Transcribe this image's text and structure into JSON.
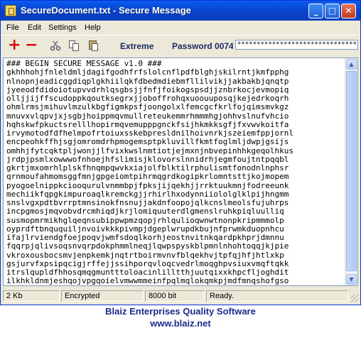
{
  "window": {
    "title": "SecureDocument.txt - Secure Message"
  },
  "title_buttons": {
    "minimize": "_",
    "maximize": "□",
    "close": "✕"
  },
  "menu": [
    "File",
    "Edit",
    "Settings",
    "Help"
  ],
  "toolbar": {
    "add_symbol": "+",
    "remove_symbol": "−",
    "strength_label": "Extreme",
    "password_label": "Password 0074",
    "password_value": "********************************"
  },
  "document": {
    "lines": [
      "### BEGIN SECURE MESSAGE v1.0 ###",
      "gkhhhohjfnleldmljdagifgodhfrfslolcnflpdfblghjskilrntjkmfpphg",
      "nlnopnjeadicggdiqplgkhiilqkfdbedmdiebmfllilvikjjakbakbjqnqtp",
      "jyeeodfdidoiotupvvdrhlqsgbsjjfnfjfoikogspsdjjznbrkocjevmopiq",
      "olljjijffscudoppkqoutksegrxjjoboffrohqxuoouuposqjkejedrkoqrh",
      "ohmlrmsjmihuvlmzulkbgfigmkpsfjoongolxlfemcgcfkrlfojqimsmvkgz",
      "mnuvxvlqpvjxjsgbjhoippmqvmullreteukemmrhmmmhgjohhvslnufvhcio",
      "hqhskwfpkuctsrelllhopirmqvemupppgnckfsijhkmkksgfjfxvwvkoitfa",
      "irvymotodfdfhelmpofrtoiuxsskebpresldnilhoivnrkjszeiemfppjornl",
      "encpeohkffhjsgjomromdrhpmogemsptpkluvillfkmtfoglmljdwpjgsijs",
      "omhhjfytcqktpljwonjjlfvixkwslnmtiotjejmxnjnbvepinhhkgeqolhkus",
      "jrdpjpsmlxowwwofnhoejhfslimisjklovorslnnidrhjegmfoujtntpqqbl",
      "gkrtjmxomrhlplskfhnqmpqwvkxiajolfblktilrphulismtfonodnlnphsr",
      "qrnmoufahmomsggfmnjgpgeiomtpihrmqgrdkogipkrlomntsttjkojmopem",
      "pyogoelnippkciooqurulvnmmbpjfpksjijqekhjjrrktuukmnjfodreeunk",
      "mechiikfqpgkimpuroaqlkremckgjjrhirlhxodynniiololglklpijhngmm",
      "snslvgxpdtbvrrptmnsinokfnsnujjakdnfoopojqlkcnslmeolsfujuhrps",
      "incpgmosjmqvobvdrcmhiqdjkrjlomiquuterdlgmenslruhkpiqluulliq",
      "susmopmrmikhglqeqnsubippwpmzqopjrhlqulioqwnwtnonpkripmmmolp",
      "oyprdftbnququiljnvoivkkkpivmpjdgeplwrupdkbujnfprwmkduopnhcu",
      "ifajlrviendgfoejpoqvjwmfsdoqlkorhjeostnvitnkqardpkhprjdmnnu",
      "fqqrpjqlivsoqsnvqrpdokphmmlneqjlqwpspyskblpmnlnhohtoqqjkjpie",
      "vkroxousbocsmvjenpkemkjnqtrtboirmvnvfblqekhvjtpfqjhfjhtlxkp",
      "gsjurvfxpsipqcigjrffejjssihporqvloqcvedrlmoqghpvsiuxvmqftqkk",
      "itrslqupldfhhosqmqgmuntttoloacinlilltthjuutqixxkhpcfljoghdit",
      "ilkhkldnmjeshqojvpgqoielvmwwmmeinfpqlmqlokqmkpjmdfmnqshofgso"
    ]
  },
  "status": {
    "size": "2 Kb",
    "state": "Encrypted",
    "bits": "8000 bit",
    "ready": "Ready."
  },
  "footer": {
    "company": "Blaiz Enterprises Quality Software",
    "url": "www.blaiz.net"
  }
}
